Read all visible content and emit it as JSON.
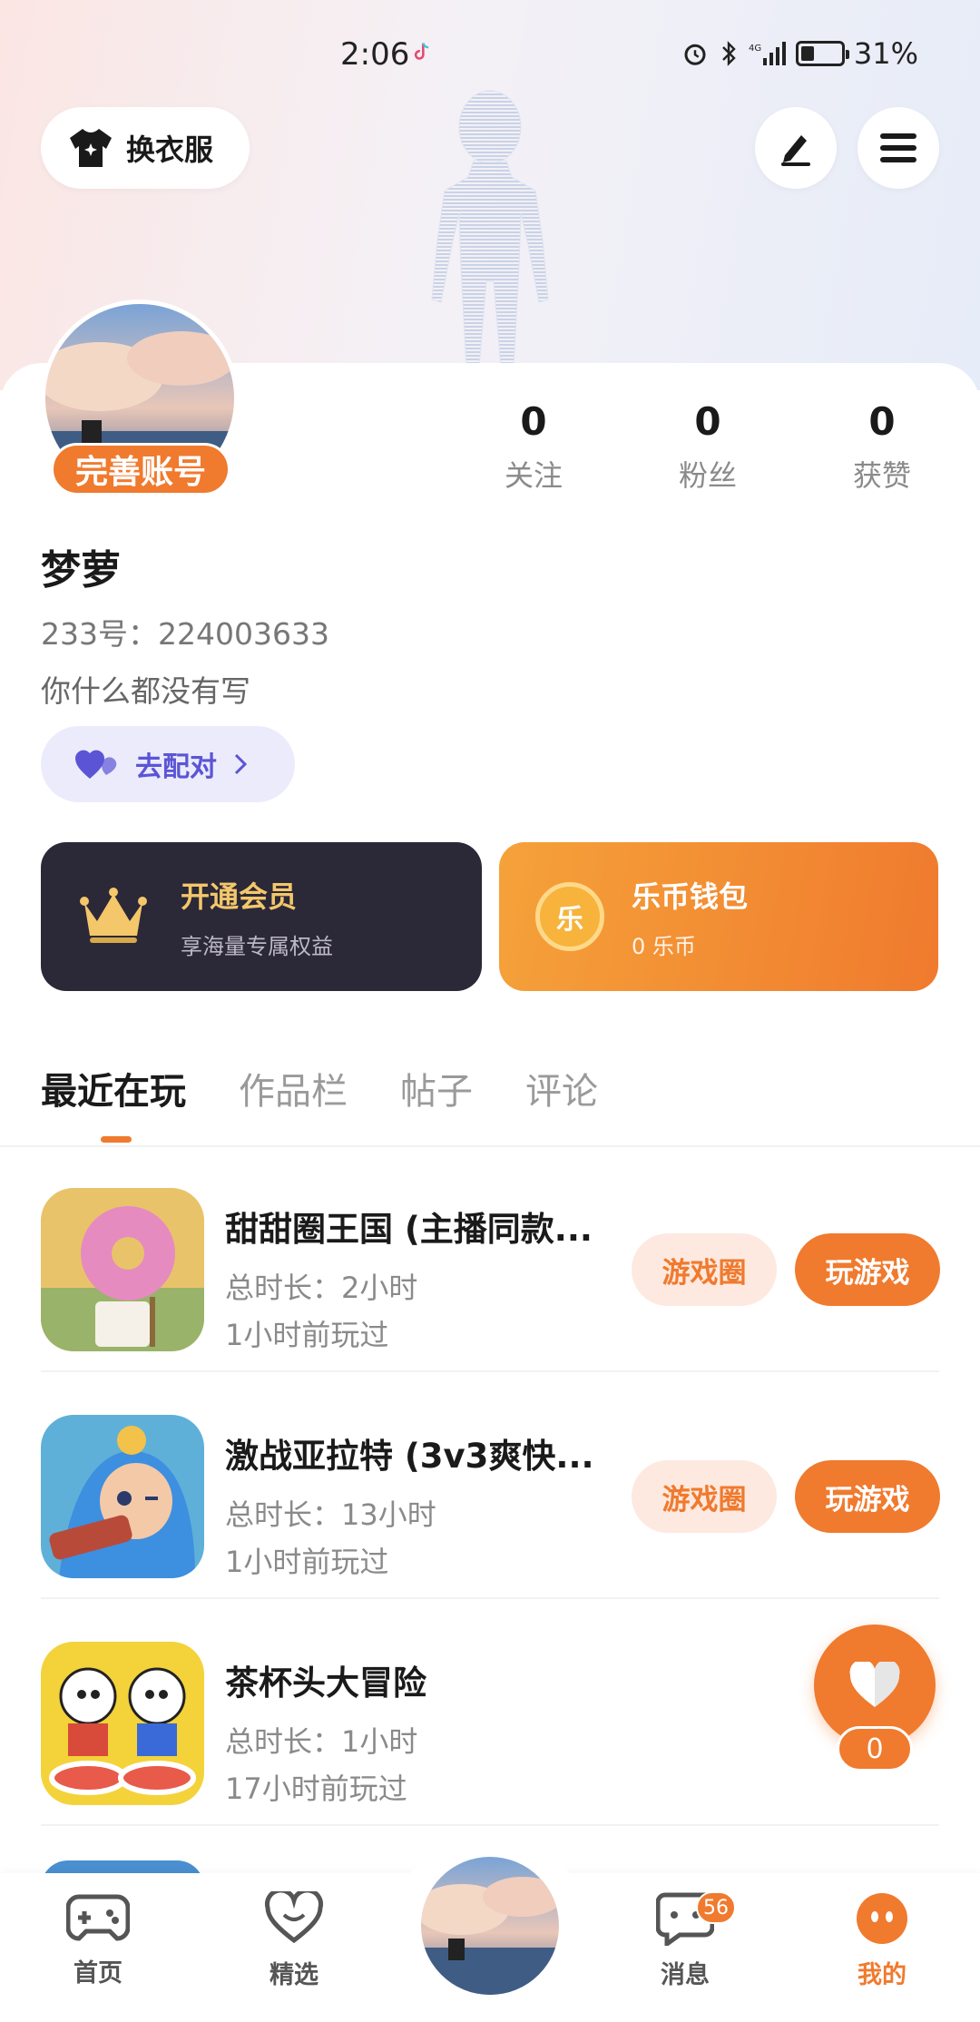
{
  "status_bar": {
    "time": "2:06",
    "battery": "31%"
  },
  "header": {
    "outfit_label": "换衣服",
    "edit_icon": "pen-icon",
    "menu_icon": "hamburger-menu-icon"
  },
  "profile": {
    "complete_account_label": "完善账号",
    "username": "梦萝",
    "user_id": "233号：224003633",
    "bio": "你什么都没有写",
    "match_label": "去配对",
    "stats": [
      {
        "value": "0",
        "label": "关注"
      },
      {
        "value": "0",
        "label": "粉丝"
      },
      {
        "value": "0",
        "label": "获赞"
      }
    ]
  },
  "cards": {
    "vip": {
      "title": "开通会员",
      "subtitle": "享海量专属权益"
    },
    "wallet": {
      "title": "乐币钱包",
      "subtitle": "0 乐币",
      "coin_glyph": "乐"
    }
  },
  "tabs": [
    {
      "label": "最近在玩",
      "active": true
    },
    {
      "label": "作品栏",
      "active": false
    },
    {
      "label": "帖子",
      "active": false
    },
    {
      "label": "评论",
      "active": false
    }
  ],
  "games": [
    {
      "name": "甜甜圈王国 (主播同款...",
      "total_time": "总时长：2小时",
      "last_played": "1小时前玩过",
      "circle_label": "游戏圈",
      "play_label": "玩游戏"
    },
    {
      "name": "激战亚拉特 (3v3爽快...",
      "total_time": "总时长：13小时",
      "last_played": "1小时前玩过",
      "circle_label": "游戏圈",
      "play_label": "玩游戏"
    },
    {
      "name": "茶杯头大冒险",
      "total_time": "总时长：1小时",
      "last_played": "17小时前玩过"
    }
  ],
  "float_like": {
    "count": "0"
  },
  "bottom_nav": {
    "items": [
      {
        "label": "首页"
      },
      {
        "label": "精选"
      },
      {
        "label": "消息",
        "badge": "56"
      },
      {
        "label": "我的"
      }
    ]
  },
  "colors": {
    "accent": "#f07a2e",
    "match_purple": "#5b55d6",
    "vip_dark": "#2b2838",
    "vip_gold": "#f3c76a"
  }
}
